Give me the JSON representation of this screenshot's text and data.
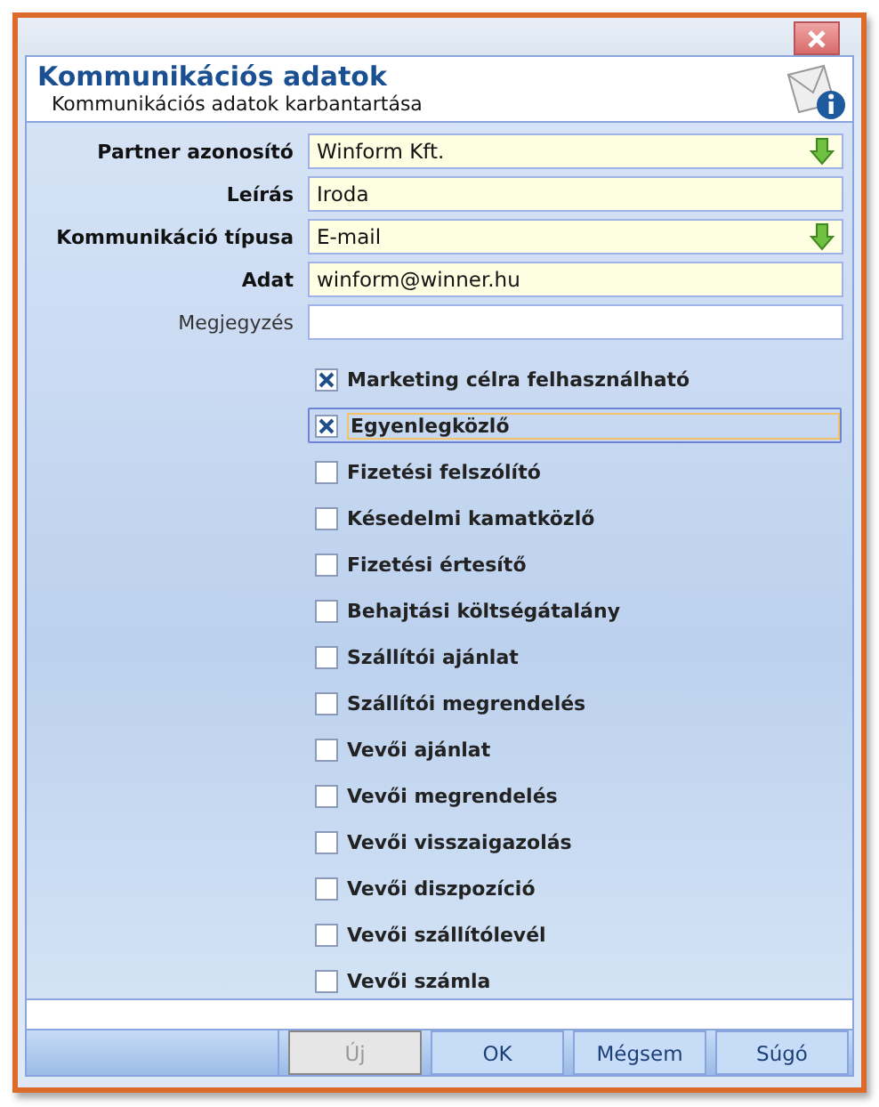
{
  "window": {
    "title": "Kommunikációs adatok",
    "subtitle": "Kommunikációs adatok karbantartása"
  },
  "fields": [
    {
      "label": "Partner azonosító",
      "value": "Winform Kft.",
      "required": true,
      "dropdown": true
    },
    {
      "label": "Leírás",
      "value": "Iroda",
      "required": true,
      "dropdown": false
    },
    {
      "label": "Kommunikáció típusa",
      "value": "E-mail",
      "required": true,
      "dropdown": true
    },
    {
      "label": "Adat",
      "value": "winform@winner.hu",
      "required": true,
      "dropdown": false
    },
    {
      "label": "Megjegyzés",
      "required": false,
      "dropdown": false
    }
  ],
  "checkboxes": [
    {
      "label": "Marketing célra felhasználható",
      "checked": true,
      "focused": false
    },
    {
      "label": "Egyenlegközlő",
      "checked": true,
      "focused": true
    },
    {
      "label": "Fizetési felszólító",
      "checked": false,
      "focused": false
    },
    {
      "label": "Késedelmi kamatközlő",
      "checked": false,
      "focused": false
    },
    {
      "label": "Fizetési értesítő",
      "checked": false,
      "focused": false
    },
    {
      "label": "Behajtási költségátalány",
      "checked": false,
      "focused": false
    },
    {
      "label": "Szállítói ajánlat",
      "checked": false,
      "focused": false
    },
    {
      "label": "Szállítói megrendelés",
      "checked": false,
      "focused": false
    },
    {
      "label": "Vevői ajánlat",
      "checked": false,
      "focused": false
    },
    {
      "label": "Vevői megrendelés",
      "checked": false,
      "focused": false
    },
    {
      "label": "Vevői visszaigazolás",
      "checked": false,
      "focused": false
    },
    {
      "label": "Vevői diszpozíció",
      "checked": false,
      "focused": false
    },
    {
      "label": "Vevői szállítólevél",
      "checked": false,
      "focused": false
    },
    {
      "label": "Vevői számla",
      "checked": false,
      "focused": false
    }
  ],
  "buttons": [
    {
      "label": "Új",
      "disabled": true
    },
    {
      "label": "OK",
      "disabled": false
    },
    {
      "label": "Mégsem",
      "disabled": false
    },
    {
      "label": "Súgó",
      "disabled": false
    }
  ]
}
